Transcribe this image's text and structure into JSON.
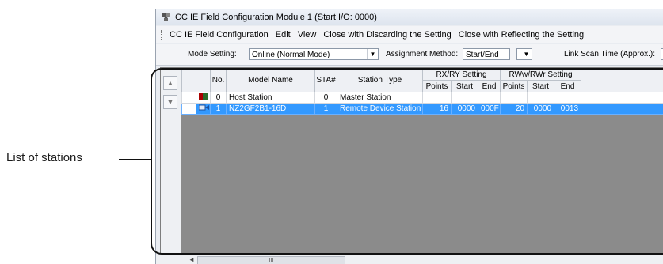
{
  "callout": {
    "label": "List of stations"
  },
  "window": {
    "title": "CC IE Field Configuration Module 1 (Start I/O: 0000)"
  },
  "menu": {
    "items": [
      "CC IE Field Configuration",
      "Edit",
      "View",
      "Close with Discarding the Setting",
      "Close with Reflecting the Setting"
    ]
  },
  "toolbar": {
    "mode_label": "Mode Setting:",
    "mode_value": "Online (Normal Mode)",
    "assign_label": "Assignment Method:",
    "assign_value": "Start/End",
    "scan_label": "Link Scan Time (Approx.):"
  },
  "side": {
    "up_icon": "triangle-up-icon",
    "down_icon": "triangle-down-icon"
  },
  "table": {
    "headers": {
      "no": "No.",
      "model": "Model Name",
      "sta": "STA#",
      "type": "Station Type",
      "rxry": "RX/RY Setting",
      "rwwrwr": "RWw/RWr Setting",
      "points": "Points",
      "start": "Start",
      "end": "End"
    },
    "rows": [
      {
        "icon": "host-station-icon",
        "no": "0",
        "model": "Host Station",
        "sta": "0",
        "type": "Master Station",
        "rx_points": "",
        "rx_start": "",
        "rx_end": "",
        "rw_points": "",
        "rw_start": "",
        "rw_end": ""
      },
      {
        "icon": "remote-station-icon",
        "no": "1",
        "model": "NZ2GF2B1-16D",
        "sta": "1",
        "type": "Remote Device Station",
        "rx_points": "16",
        "rx_start": "0000",
        "rx_end": "000F",
        "rw_points": "20",
        "rw_start": "0000",
        "rw_end": "0013"
      }
    ]
  },
  "scrollbar": {
    "thumb_text": "III"
  },
  "colors": {
    "selection": "#3399ff",
    "panel": "#8b8b8b"
  }
}
